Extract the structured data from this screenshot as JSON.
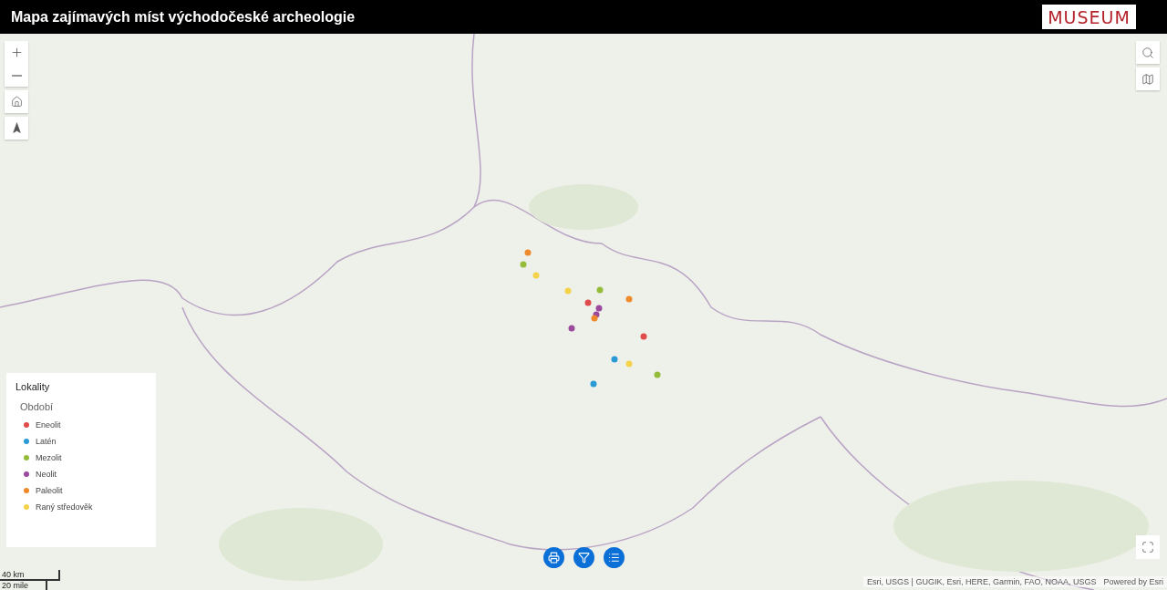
{
  "header": {
    "title": "Mapa zajímavých míst východočeské archeologie",
    "logo": "MUSEUM"
  },
  "legend": {
    "title": "Lokality",
    "subtitle": "Období",
    "items": [
      {
        "label": "Eneolit",
        "color": "#e04b4b"
      },
      {
        "label": "Latén",
        "color": "#2a9ad4"
      },
      {
        "label": "Mezolit",
        "color": "#94bb3a"
      },
      {
        "label": "Neolit",
        "color": "#9b4a9e"
      },
      {
        "label": "Paleolit",
        "color": "#ee8a2a"
      },
      {
        "label": "Raný středověk",
        "color": "#f4d34a"
      }
    ]
  },
  "sites": [
    {
      "color": "#ee8a2a"
    },
    {
      "color": "#94bb3a"
    },
    {
      "color": "#f4d34a"
    },
    {
      "color": "#f4d34a"
    },
    {
      "color": "#94bb3a"
    },
    {
      "color": "#ee8a2a"
    },
    {
      "color": "#e04b4b"
    },
    {
      "color": "#9b4a9e"
    },
    {
      "color": "#9b4a9e"
    },
    {
      "color": "#ee8a2a"
    },
    {
      "color": "#9b4a9e"
    },
    {
      "color": "#e04b4b"
    },
    {
      "color": "#2a9ad4"
    },
    {
      "color": "#f4d34a"
    },
    {
      "color": "#94bb3a"
    },
    {
      "color": "#2a9ad4"
    }
  ],
  "scale": {
    "metric": "40 km",
    "imperial": "20 mile"
  },
  "attribution": {
    "sources": "Esri, USGS | GUGIK, Esri, HERE, Garmin, FAO, NOAA, USGS",
    "powered": "Powered by Esri"
  }
}
